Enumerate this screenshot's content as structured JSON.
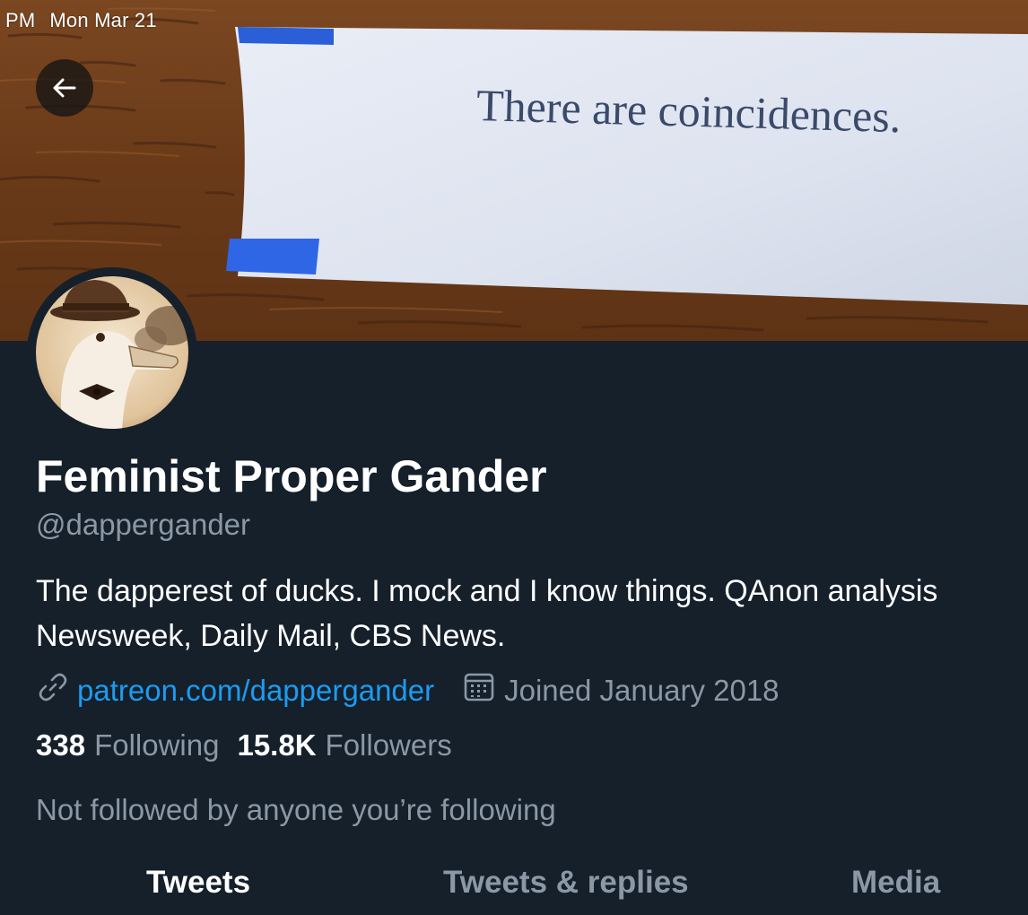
{
  "status_bar": {
    "time": "PM",
    "date": "Mon Mar 21"
  },
  "banner": {
    "fortune_text": "There are coincidences."
  },
  "profile": {
    "display_name": "Feminist Proper Gander",
    "handle": "@dappergander",
    "bio_line1": "The dapperest of ducks. I mock and I know things. QAnon analysis",
    "bio_line2": "Newsweek, Daily Mail, CBS News.",
    "link": "patreon.com/dappergander",
    "joined": "Joined January 2018",
    "following_count": "338",
    "following_label": "Following",
    "followers_count": "15.8K",
    "followers_label": "Followers",
    "not_followed_note": "Not followed by anyone you’re following"
  },
  "tabs": [
    {
      "label": "Tweets",
      "active": true
    },
    {
      "label": "Tweets & replies",
      "active": false
    },
    {
      "label": "Media",
      "active": false
    }
  ],
  "icons": {
    "back": "arrow-left-icon",
    "link": "link-icon",
    "calendar": "calendar-icon"
  },
  "colors": {
    "background": "#15202b",
    "accent_link": "#1d9bf0",
    "secondary_text": "#8b98a5",
    "primary_text": "#ffffff"
  }
}
